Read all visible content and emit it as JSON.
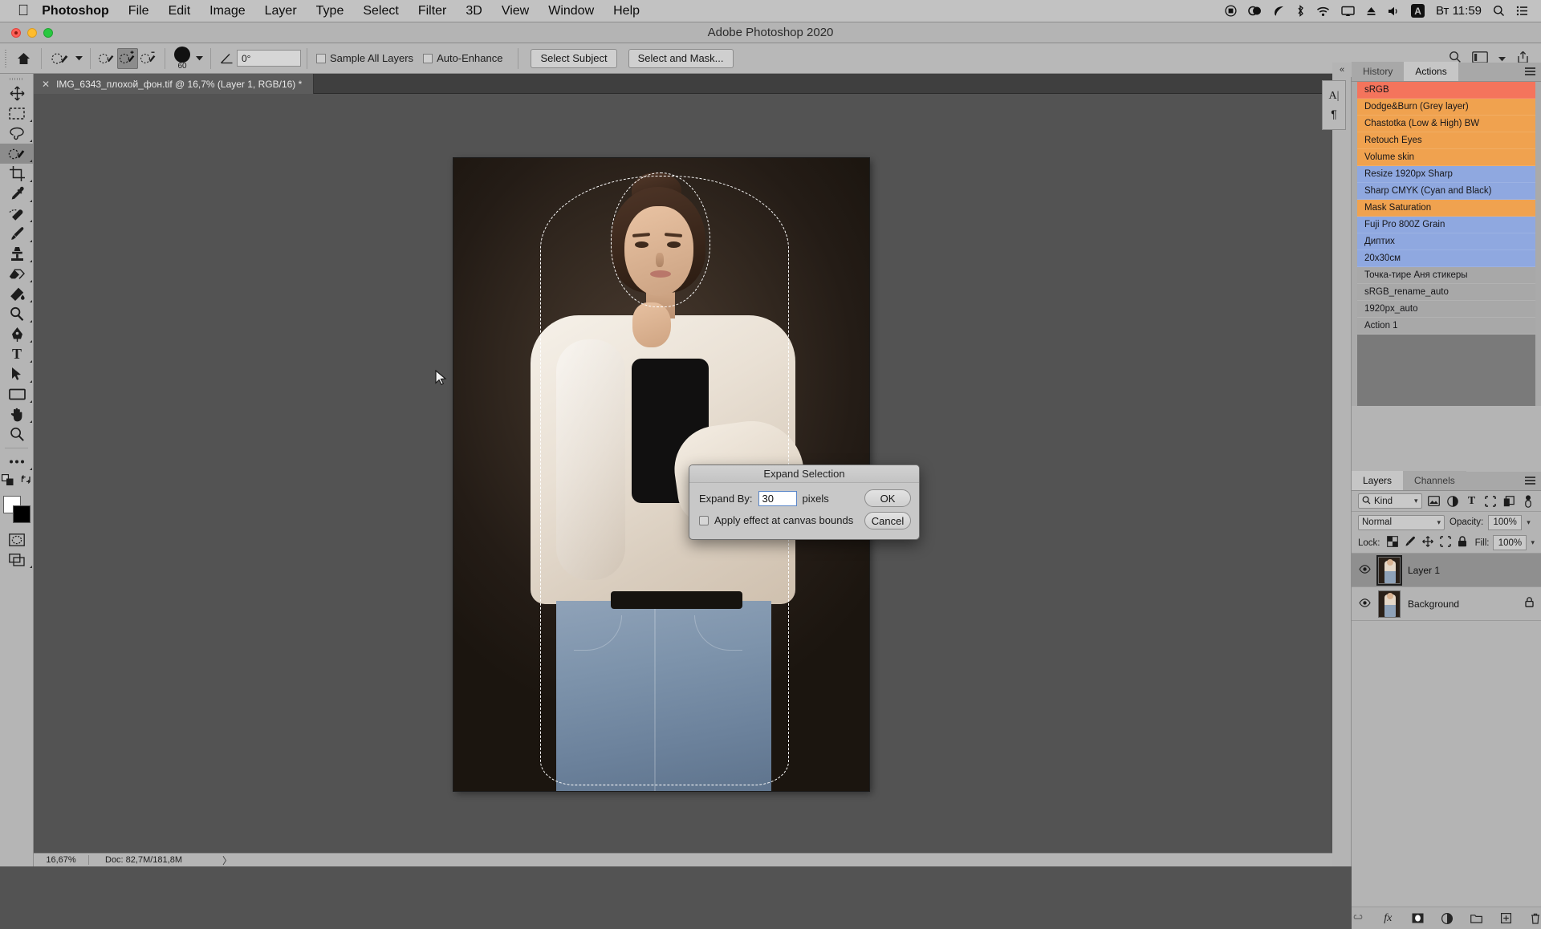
{
  "macbar": {
    "apple_icon": "apple-icon",
    "menus": [
      "Photoshop",
      "File",
      "Edit",
      "Image",
      "Layer",
      "Type",
      "Select",
      "Filter",
      "3D",
      "View",
      "Window",
      "Help"
    ],
    "status_icons": [
      "record-icon",
      "cloud-link-icon",
      "leaf-icon",
      "bluetooth-icon",
      "wifi-icon",
      "airplay-icon",
      "eject-icon",
      "volume-icon",
      "input-source-icon"
    ],
    "input_source": "A",
    "clock": "Вт 11:59",
    "search_icon": "search-icon",
    "control_center_icon": "control-center-icon"
  },
  "window": {
    "title": "Adobe Photoshop 2020",
    "traffic_lights": [
      "close-button",
      "minimize-button",
      "zoom-button"
    ]
  },
  "options_bar": {
    "home_icon": "home-icon",
    "tool_preset_icon": "quick-selection-preset-icon",
    "mode_new": "new-selection-icon",
    "mode_add": "add-to-selection-icon",
    "mode_subtract": "subtract-from-selection-icon",
    "brush_size": "60",
    "angle_label": "angle-icon",
    "angle_value": "0°",
    "sample_all_layers": "Sample All Layers",
    "auto_enhance": "Auto-Enhance",
    "select_subject": "Select Subject",
    "select_and_mask": "Select and Mask...",
    "right_search_icon": "search-icon",
    "right_workspace_icon": "workspace-icon",
    "right_share_icon": "share-icon"
  },
  "document": {
    "tab_title": "IMG_6343_плохой_фон.tif @ 16,7% (Layer 1, RGB/16) *",
    "close_icon": "close-icon"
  },
  "tools": [
    {
      "name": "move-tool",
      "glyph": "✥",
      "selected": false,
      "has_submenu": false
    },
    {
      "name": "rectangular-marquee-tool",
      "glyph": "⬚",
      "selected": false,
      "has_submenu": true
    },
    {
      "name": "lasso-tool",
      "glyph": "❦",
      "selected": false,
      "has_submenu": true
    },
    {
      "name": "quick-selection-tool",
      "glyph": "❁",
      "selected": true,
      "has_submenu": true
    },
    {
      "name": "crop-tool",
      "glyph": "⌗",
      "selected": false,
      "has_submenu": true
    },
    {
      "name": "eyedropper-tool",
      "glyph": "✒",
      "selected": false,
      "has_submenu": true
    },
    {
      "name": "spot-healing-brush-tool",
      "glyph": "✇",
      "selected": false,
      "has_submenu": true
    },
    {
      "name": "brush-tool",
      "glyph": "✎",
      "selected": false,
      "has_submenu": true
    },
    {
      "name": "clone-stamp-tool",
      "glyph": "⚫",
      "selected": false,
      "has_submenu": true
    },
    {
      "name": "eraser-tool",
      "glyph": "▱",
      "selected": false,
      "has_submenu": true
    },
    {
      "name": "gradient-tool",
      "glyph": "◧",
      "selected": false,
      "has_submenu": true
    },
    {
      "name": "dodge-tool",
      "glyph": "○",
      "selected": false,
      "has_submenu": true
    },
    {
      "name": "pen-tool",
      "glyph": "✑",
      "selected": false,
      "has_submenu": true
    },
    {
      "name": "horizontal-type-tool",
      "glyph": "T",
      "selected": false,
      "has_submenu": true
    },
    {
      "name": "path-selection-tool",
      "glyph": "➤",
      "selected": false,
      "has_submenu": true
    },
    {
      "name": "rectangle-tool",
      "glyph": "▭",
      "selected": false,
      "has_submenu": true
    },
    {
      "name": "hand-tool",
      "glyph": "✋",
      "selected": false,
      "has_submenu": true
    },
    {
      "name": "zoom-tool",
      "glyph": "⌕",
      "selected": false,
      "has_submenu": false
    },
    {
      "name": "edit-toolbar-tool",
      "glyph": "•••",
      "selected": false,
      "has_submenu": false
    }
  ],
  "tool_extras": {
    "default_colors_icon": "default-colors-icon",
    "swap_colors_icon": "swap-colors-icon",
    "foreground_color": "#ffffff",
    "background_color": "#000000",
    "quick_mask_icon": "quick-mask-icon",
    "screen_mode_icon": "screen-mode-icon"
  },
  "dialog": {
    "title": "Expand Selection",
    "expand_by_label": "Expand By:",
    "expand_by_value": "30",
    "pixels_label": "pixels",
    "checkbox_label": "Apply effect at canvas bounds",
    "checkbox_checked": false,
    "ok_label": "OK",
    "cancel_label": "Cancel"
  },
  "status_bar": {
    "zoom": "16,67%",
    "doc_info": "Doc: 82,7M/181,8M",
    "expand_arrow": "〉"
  },
  "right_dock": {
    "collapse_icon": "collapse-panels-icon",
    "character_icon": "character-panel-icon",
    "paragraph_icon": "paragraph-panel-icon"
  },
  "actions_panel": {
    "tabs": [
      {
        "label": "History",
        "active": false
      },
      {
        "label": "Actions",
        "active": true
      }
    ],
    "menu_icon": "panel-menu-icon",
    "colors": {
      "red": "#f4745c",
      "orange": "#f0a24f",
      "blue": "#8fa8e0",
      "gray": "#a8a8a8"
    },
    "items": [
      {
        "label": "sRGB",
        "color": "red"
      },
      {
        "label": "Dodge&Burn (Grey layer)",
        "color": "orange"
      },
      {
        "label": "Chastotka (Low & High) BW",
        "color": "orange"
      },
      {
        "label": "Retouch Eyes",
        "color": "orange"
      },
      {
        "label": "Volume skin",
        "color": "orange"
      },
      {
        "label": "Resize 1920px Sharp",
        "color": "blue"
      },
      {
        "label": "Sharp CMYK (Cyan and Black)",
        "color": "blue"
      },
      {
        "label": "Mask Saturation",
        "color": "orange"
      },
      {
        "label": "Fuji Pro 800Z Grain",
        "color": "blue"
      },
      {
        "label": "Диптих",
        "color": "blue"
      },
      {
        "label": "20х30см",
        "color": "blue"
      },
      {
        "label": "Точка-тире Аня стикеры",
        "color": "gray"
      },
      {
        "label": "sRGB_rename_auto",
        "color": "gray"
      },
      {
        "label": "1920px_auto",
        "color": "gray"
      },
      {
        "label": "Action 1",
        "color": "gray"
      }
    ]
  },
  "layers_panel": {
    "tabs": [
      {
        "label": "Layers",
        "active": true
      },
      {
        "label": "Channels",
        "active": false
      }
    ],
    "menu_icon": "panel-menu-icon",
    "filter": {
      "search_icon": "search-icon",
      "kind_label": "Kind",
      "icons": [
        "pixel-layer-filter-icon",
        "adjustment-layer-filter-icon",
        "type-layer-filter-icon",
        "shape-layer-filter-icon",
        "smart-object-filter-icon",
        "filter-toggle-icon"
      ]
    },
    "blend_mode": "Normal",
    "opacity_label": "Opacity:",
    "opacity_value": "100%",
    "lock_label": "Lock:",
    "lock_icons": [
      "lock-transparent-pixels-icon",
      "lock-image-pixels-icon",
      "lock-position-icon",
      "lock-artboard-icon",
      "lock-all-icon"
    ],
    "fill_label": "Fill:",
    "fill_value": "100%",
    "layers": [
      {
        "name": "Layer 1",
        "visible": true,
        "selected": true,
        "locked": false
      },
      {
        "name": "Background",
        "visible": true,
        "selected": false,
        "locked": true
      }
    ],
    "bottom_buttons": [
      {
        "name": "link-layers-button",
        "glyph": "⚭"
      },
      {
        "name": "layer-style-button",
        "glyph": "fx"
      },
      {
        "name": "layer-mask-button",
        "glyph": "▣"
      },
      {
        "name": "adjustment-layer-button",
        "glyph": "◑"
      },
      {
        "name": "new-group-button",
        "glyph": "▱"
      },
      {
        "name": "new-layer-button",
        "glyph": "⊞"
      },
      {
        "name": "delete-layer-button",
        "glyph": "🗑"
      }
    ]
  },
  "canvas": {
    "image_alt": "portrait-photo-woman-white-shirt-jeans",
    "selection_state": "active-marching-ants-selection",
    "cursor": "arrow-cursor"
  }
}
